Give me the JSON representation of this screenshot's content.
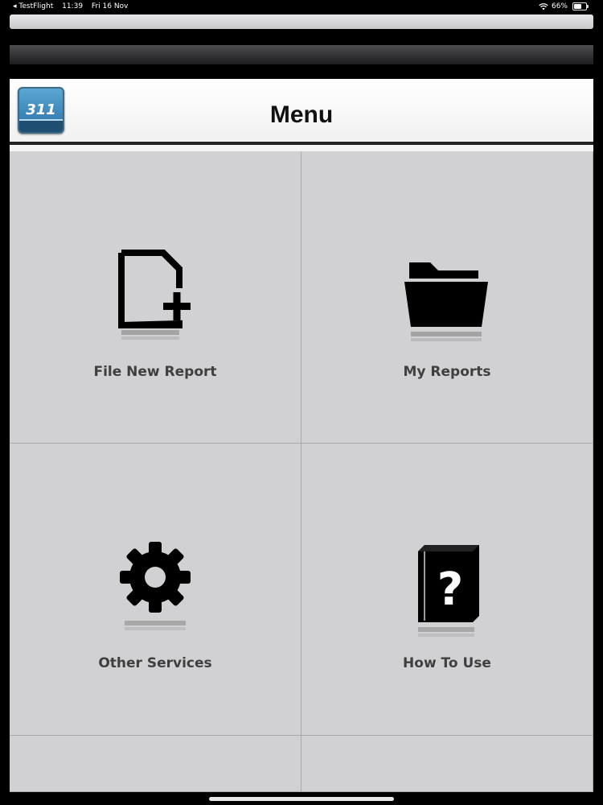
{
  "status_bar": {
    "back_app": "◂ TestFlight",
    "time": "11:39",
    "date": "Fri 16 Nov",
    "battery_text": "66%",
    "battery_level": 0.66
  },
  "header": {
    "title": "Menu",
    "logo_text": "311"
  },
  "menu": {
    "items": [
      {
        "label": "File New Report",
        "icon": "file-add-icon"
      },
      {
        "label": "My Reports",
        "icon": "folder-icon"
      },
      {
        "label": "Other Services",
        "icon": "gear-icon"
      },
      {
        "label": "How To Use",
        "icon": "help-book-icon"
      }
    ]
  },
  "colors": {
    "grid_background": "#d1d1d3",
    "label": "#3f3f3f",
    "icon": "#000000",
    "divider": "#a9a9ab"
  }
}
